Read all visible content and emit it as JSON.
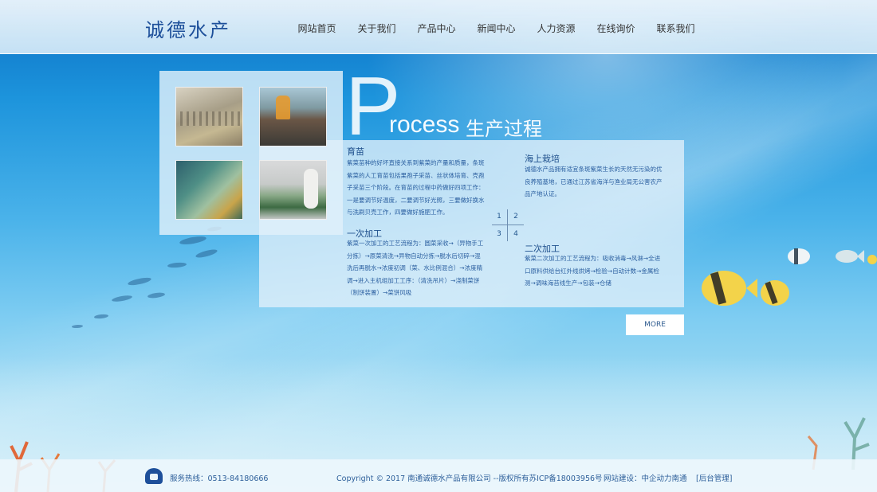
{
  "header": {
    "logo": "诚德水产",
    "nav": [
      "网站首页",
      "关于我们",
      "产品中心",
      "新闻中心",
      "人力资源",
      "在线询价",
      "联系我们"
    ]
  },
  "process": {
    "big_letter": "P",
    "rest_word": "rocess",
    "cn_title": "生产过程"
  },
  "blocks": {
    "b1": {
      "title": "育苗",
      "lines": [
        "紫菜苗种的好坏直接关系到紫菜的产量和质量，条斑",
        "紫菜的人工育苗包括果孢子采苗、丝状体培育、壳孢",
        "子采苗三个阶段。在育苗的过程中药做好四项工作：",
        "一是要调节好温度，二要调节好光照，三要做好换水",
        "与洗刷贝壳工作，四要做好施肥工作。"
      ]
    },
    "b2": {
      "title": "海上栽培",
      "lines": [
        "诚德水产品拥有适宜条斑紫菜生长的天然无污染的优",
        "良养殖基地，已通过江苏省海洋与渔业局无公害农产",
        "品产地认证。"
      ]
    },
    "b3": {
      "title": "一次加工",
      "lines": [
        "紫菜一次加工的工艺流程为：圆菜采收→（异物手工",
        "分拣）→原菜清洗→异物自动分拣→脱水后切碎→混",
        "洗后再脱水→浓度初调（菜、水比例混合）→浓度精",
        "调→进入主机组加工工序：（清洗吊片）→浇制菜饼",
        "（制饼装置）→菜饼风吸"
      ]
    },
    "b4": {
      "title": "二次加工",
      "lines": [
        "紫菜二次加工的工艺流程为：吸收消毒→风淋→全进",
        "口原料供给台红外线烘烤→检验→自动计数→金属检",
        "测→调味海苔线生产→包装→仓储"
      ]
    }
  },
  "numbers": [
    "1",
    "2",
    "3",
    "4"
  ],
  "more_label": "MORE",
  "footer": {
    "hotline": "服务热线：0513-84180666",
    "copyright": "Copyright © 2017 南通诚德水产品有限公司 --版权所有苏ICP备18003956号",
    "builder": "网站建设：中企动力南通",
    "admin": "[后台管理]"
  }
}
